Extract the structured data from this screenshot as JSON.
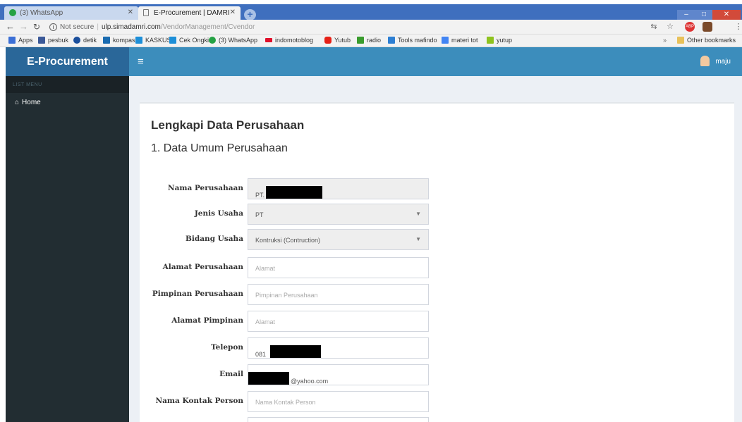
{
  "browser": {
    "tabs": [
      {
        "title": "(3) WhatsApp",
        "active": false
      },
      {
        "title": "E-Procurement | DAMRI",
        "active": true
      }
    ],
    "address": {
      "security": "Not secure",
      "host": "ulp.simadamri.com",
      "path": "/VendorManagement/Cvendor"
    },
    "bookmarks": [
      {
        "label": "Apps",
        "icon": "apps-grid-icon",
        "color": "#5f6368"
      },
      {
        "label": "pesbuk",
        "icon": "facebook-icon",
        "color": "#3b5998"
      },
      {
        "label": "detik",
        "icon": "detik-icon",
        "color": "#1b4f9c"
      },
      {
        "label": "kompas",
        "icon": "kompas-icon",
        "color": "#1a6bb0"
      },
      {
        "label": "KASKUS",
        "icon": "kaskus-icon",
        "color": "#1d8fd8"
      },
      {
        "label": "Cek Ongkir",
        "icon": "cek-ongkir-icon",
        "color": "#1d8fd8"
      },
      {
        "label": "(3) WhatsApp",
        "icon": "whatsapp-icon",
        "color": "#25a244"
      },
      {
        "label": "indomotoblog",
        "icon": "indomotoblog-icon",
        "color": "#e0102a"
      },
      {
        "label": "Yutub",
        "icon": "youtube-icon",
        "color": "#e62117"
      },
      {
        "label": "radio",
        "icon": "radio-icon",
        "color": "#3a9c2e"
      },
      {
        "label": "Tools mafindo",
        "icon": "tools-icon",
        "color": "#2d7fd3"
      },
      {
        "label": "materi tot",
        "icon": "docs-icon",
        "color": "#4285f4"
      },
      {
        "label": "yutup",
        "icon": "yutup-icon",
        "color": "#8fc31f"
      },
      {
        "label": "Other bookmarks",
        "icon": "folder-icon",
        "color": "#e8c15a"
      }
    ]
  },
  "app": {
    "brand": "E-Procurement",
    "user_name": "maju",
    "sidebar_header": "LIST MENU",
    "sidebar_items": [
      {
        "label": "Home",
        "icon": "home-icon"
      }
    ]
  },
  "form": {
    "title": "Lengkapi Data Perusahaan",
    "section": "1. Data Umum Perusahaan",
    "fields": [
      {
        "label": "Nama Perusahaan",
        "value": "PT.",
        "placeholder": "",
        "readonly": true
      },
      {
        "label": "Jenis Usaha",
        "value": "PT",
        "type": "select"
      },
      {
        "label": "Bidang Usaha",
        "value": "Kontruksi (Contruction)",
        "type": "select"
      },
      {
        "label": "Alamat Perusahaan",
        "value": "",
        "placeholder": "Alamat"
      },
      {
        "label": "Pimpinan Perusahaan",
        "value": "",
        "placeholder": "Pimpinan Perusahaan"
      },
      {
        "label": "Alamat Pimpinan",
        "value": "",
        "placeholder": "Alamat"
      },
      {
        "label": "Telepon",
        "value": "081",
        "placeholder": ""
      },
      {
        "label": "Email",
        "value": "@yahoo.com",
        "placeholder": ""
      },
      {
        "label": "Nama Kontak Person",
        "value": "",
        "placeholder": "Nama Kontak Person"
      }
    ]
  },
  "colors": {
    "brand_bg": "#2a6799",
    "topnav_bg": "#3c8dbc",
    "sidebar_bg": "#222d32",
    "content_bg": "#ecf0f5"
  }
}
